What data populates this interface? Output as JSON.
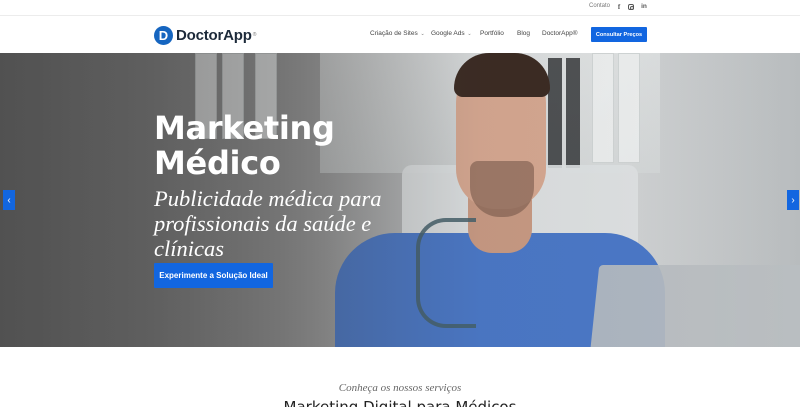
{
  "topbar": {
    "contact": "Contato",
    "social": [
      {
        "icon": "facebook-icon",
        "glyph": "f"
      },
      {
        "icon": "instagram-icon",
        "glyph": ""
      },
      {
        "icon": "linkedin-icon",
        "glyph": "in"
      }
    ]
  },
  "header": {
    "logo_text": "DoctorApp",
    "logo_reg": "®",
    "logo_mark": "D",
    "nav": [
      {
        "label": "Criação de Sites",
        "dropdown": true
      },
      {
        "label": "Google Ads",
        "dropdown": true
      },
      {
        "label": "Portfólio",
        "dropdown": false
      },
      {
        "label": "Blog",
        "dropdown": false
      },
      {
        "label": "DoctorApp®",
        "dropdown": false
      }
    ],
    "cta": "Consultar Preços",
    "chevron": "⌄"
  },
  "hero": {
    "title": "Marketing Médico",
    "subtitle": "Publicidade médica para profissionais da saúde e clínicas",
    "button": "Experimente a Solução Ideal",
    "arrow_left": "‹",
    "arrow_right": "›"
  },
  "services": {
    "eyebrow": "Conheça os nossos serviços",
    "title": "Marketing Digital para Médicos"
  },
  "colors": {
    "accent": "#1266e0",
    "logo_blue": "#1565c0"
  }
}
